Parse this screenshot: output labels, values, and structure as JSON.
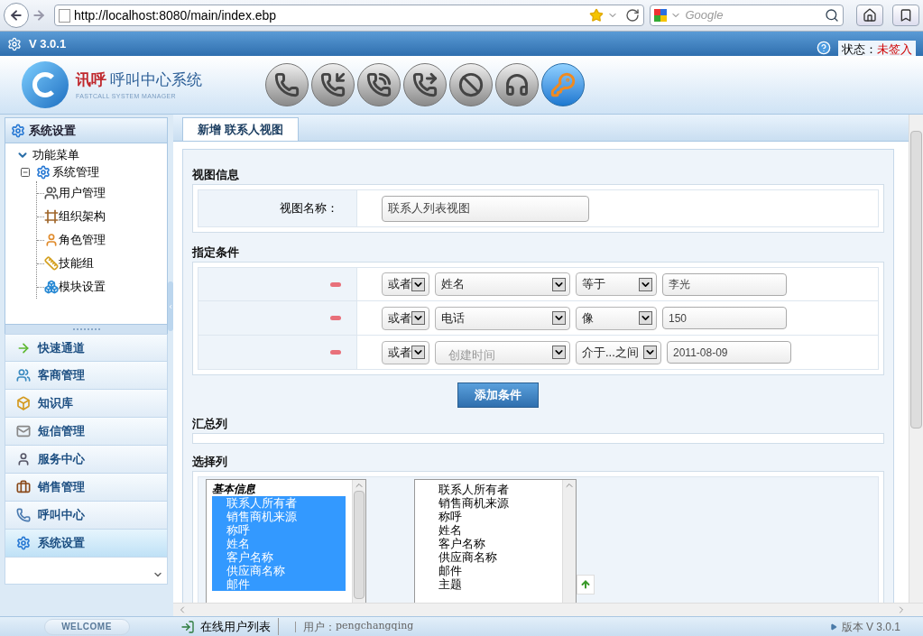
{
  "browser": {
    "url": "http://localhost:8080/main/index.ebp",
    "search_placeholder": "Google"
  },
  "app_bar": {
    "version": "V 3.0.1",
    "status_label": "状态：",
    "status_value": "未签入"
  },
  "logo": {
    "brand": "讯呼",
    "title": "呼叫中心系统",
    "subtitle": "FASTCALL SYSTEM MANAGER"
  },
  "toolbar": [
    {
      "selected": false
    },
    {
      "selected": false
    },
    {
      "selected": false
    },
    {
      "selected": false
    },
    {
      "selected": false
    },
    {
      "selected": false
    },
    {
      "selected": true
    }
  ],
  "sidebar": {
    "title": "系统设置",
    "tree": [
      {
        "label": "功能菜单",
        "expanded": true,
        "children": [
          {
            "label": "系统管理",
            "expanded": true,
            "children": [
              {
                "label": "用户管理"
              },
              {
                "label": "组织架构"
              },
              {
                "label": "角色管理"
              },
              {
                "label": "技能组"
              },
              {
                "label": "模块设置"
              }
            ]
          }
        ]
      }
    ],
    "accordion": [
      {
        "label": "快速通道",
        "selected": false
      },
      {
        "label": "客商管理",
        "selected": false
      },
      {
        "label": "知识库",
        "selected": false
      },
      {
        "label": "短信管理",
        "selected": false
      },
      {
        "label": "服务中心",
        "selected": false
      },
      {
        "label": "销售管理",
        "selected": false
      },
      {
        "label": "呼叫中心",
        "selected": false
      },
      {
        "label": "系统设置",
        "selected": true
      }
    ],
    "welcome": "WELCOME"
  },
  "tabs": [
    {
      "label": "新增 联系人视图",
      "selected": true
    }
  ],
  "view_info": {
    "heading": "视图信息",
    "label": "视图名称：",
    "value": "联系人列表视图"
  },
  "conditions": {
    "heading": "指定条件",
    "add_button": "添加条件",
    "rows": [
      {
        "logic": "或者",
        "field": "姓名",
        "field_dimmed": false,
        "operator": "等于",
        "value": "李光"
      },
      {
        "logic": "或者",
        "field": "电话",
        "field_dimmed": false,
        "operator": "像",
        "value": "150"
      },
      {
        "logic": "或者",
        "field": "创建时间",
        "field_dimmed": true,
        "operator": "介于...之间",
        "value": "2011-08-09"
      }
    ]
  },
  "summary": {
    "heading": "汇总列"
  },
  "select_columns": {
    "heading": "选择列",
    "available": [
      {
        "kind": "group",
        "label": "基本信息"
      },
      {
        "kind": "option",
        "label": "联系人所有者",
        "selected": true
      },
      {
        "kind": "option",
        "label": "销售商机来源",
        "selected": true
      },
      {
        "kind": "option",
        "label": "称呼",
        "selected": true
      },
      {
        "kind": "option",
        "label": "姓名",
        "selected": true
      },
      {
        "kind": "option",
        "label": "客户名称",
        "selected": true
      },
      {
        "kind": "option",
        "label": "供应商名称",
        "selected": true
      },
      {
        "kind": "option",
        "label": "邮件",
        "selected": true
      }
    ],
    "chosen": [
      {
        "label": "联系人所有者",
        "selected": false
      },
      {
        "label": "销售商机来源",
        "selected": false
      },
      {
        "label": "称呼",
        "selected": false
      },
      {
        "label": "姓名",
        "selected": false
      },
      {
        "label": "客户名称",
        "selected": false
      },
      {
        "label": "供应商名称",
        "selected": false
      },
      {
        "label": "邮件",
        "selected": false
      },
      {
        "label": "主题",
        "selected": false
      }
    ]
  },
  "status_bar": {
    "online_users": "在线用户列表",
    "user_label": "用户：",
    "user": "pengchangqing",
    "version": "版本 V 3.0.1"
  }
}
